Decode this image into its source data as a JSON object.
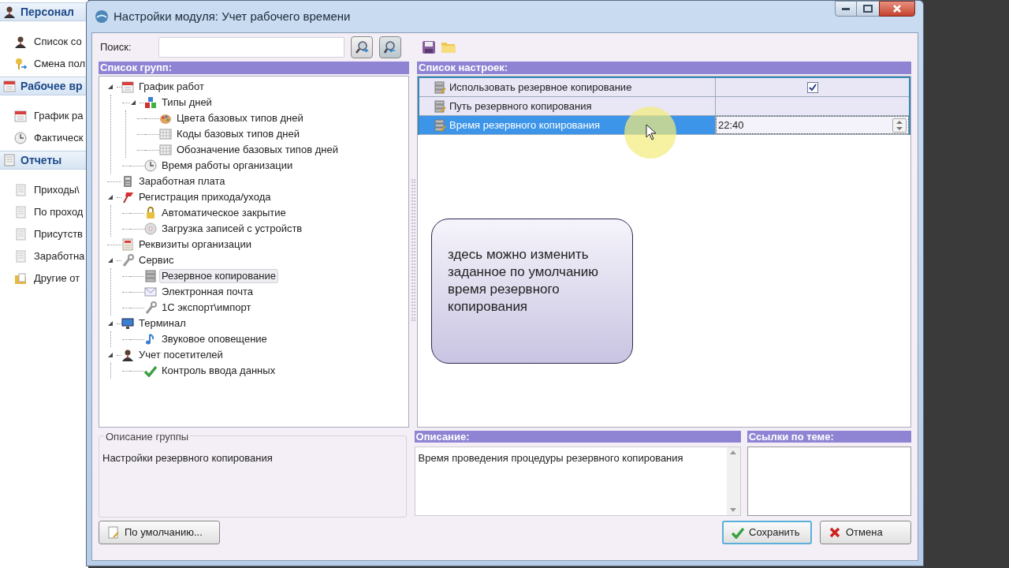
{
  "background_app": {
    "sidebar": [
      {
        "kind": "header",
        "label": "Персонал"
      },
      {
        "kind": "item",
        "label": "Список со"
      },
      {
        "kind": "item",
        "label": "Смена пол"
      },
      {
        "kind": "header",
        "label": "Рабочее вр"
      },
      {
        "kind": "item",
        "label": "График ра"
      },
      {
        "kind": "item",
        "label": "Фактическ"
      },
      {
        "kind": "header",
        "label": "Отчеты"
      },
      {
        "kind": "item",
        "label": "Приходы\\"
      },
      {
        "kind": "item",
        "label": "По проход"
      },
      {
        "kind": "item",
        "label": "Присутств"
      },
      {
        "kind": "item",
        "label": "Заработна"
      },
      {
        "kind": "item",
        "label": "Другие от"
      }
    ]
  },
  "dialog": {
    "title": "Настройки модуля: Учет рабочего времени",
    "search": {
      "label": "Поиск:"
    },
    "groups_header": "Список групп:",
    "tree": [
      {
        "label": "График работ",
        "selected": false,
        "expanded": true,
        "children": [
          {
            "label": "Типы дней",
            "selected": false,
            "expanded": true,
            "children": [
              {
                "label": "Цвета базовых типов дней",
                "selected": false
              },
              {
                "label": "Коды базовых типов дней",
                "selected": false
              },
              {
                "label": "Обозначение базовых типов дней",
                "selected": false
              }
            ]
          },
          {
            "label": "Время работы организации",
            "selected": false
          }
        ]
      },
      {
        "label": "Заработная плата",
        "selected": false
      },
      {
        "label": "Регистрация прихода/ухода",
        "selected": false,
        "expanded": true,
        "children": [
          {
            "label": "Автоматическое закрытие",
            "selected": false
          },
          {
            "label": "Загрузка записей с устройств",
            "selected": false
          }
        ]
      },
      {
        "label": "Реквизиты организации",
        "selected": false
      },
      {
        "label": "Сервис",
        "selected": false,
        "expanded": true,
        "children": [
          {
            "label": "Резервное копирование",
            "selected": true
          },
          {
            "label": "Электронная почта",
            "selected": false
          },
          {
            "label": "1С экспорт\\импорт",
            "selected": false
          }
        ]
      },
      {
        "label": "Терминал",
        "selected": false,
        "expanded": true,
        "children": [
          {
            "label": "Звуковое оповещение",
            "selected": false
          }
        ]
      },
      {
        "label": "Учет посетителей",
        "selected": false,
        "expanded": true,
        "children": [
          {
            "label": "Контроль ввода данных",
            "selected": false
          }
        ]
      }
    ],
    "settings_header": "Список настроек:",
    "settings": [
      {
        "name": "Использовать резервное копирование",
        "kind": "checkbox",
        "checked": true,
        "selected": false
      },
      {
        "name": "Путь резервного копирования",
        "kind": "text",
        "selected": false
      },
      {
        "name": "Время резервного копирования",
        "kind": "time",
        "value": "22:40",
        "selected": true
      }
    ],
    "callout": "здесь можно изменить заданное по умолчанию время резервного копирования",
    "group_description": {
      "legend": "Описание группы",
      "text": "Настройки резервного копирования"
    },
    "description": {
      "header": "Описание:",
      "text": "Время проведения процедуры резервного копирования"
    },
    "links": {
      "header": "Ссылки по теме:"
    },
    "buttons": [
      {
        "label": "По умолчанию...",
        "kind": "default"
      },
      {
        "label": "Сохранить",
        "kind": "save"
      },
      {
        "label": "Отмена",
        "kind": "cancel"
      }
    ]
  }
}
